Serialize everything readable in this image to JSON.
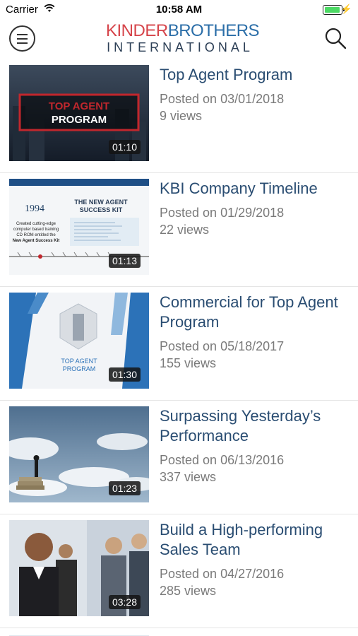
{
  "status_bar": {
    "carrier": "Carrier",
    "time": "10:58 AM"
  },
  "header": {
    "logo_line1_part1": "KINDER",
    "logo_line1_part2": "BROTHERS",
    "logo_line2": "INTERNATIONAL",
    "icons": {
      "menu": "menu-icon",
      "search": "search-icon"
    }
  },
  "videos": [
    {
      "title": "Top Agent Program",
      "posted": "Posted on 03/01/2018",
      "views": "9 views",
      "duration": "01:10",
      "thumb_text": [
        "TOP AGENT",
        "PROGRAM"
      ]
    },
    {
      "title": "KBI Company Timeline",
      "posted": "Posted on 01/29/2018",
      "views": "22 views",
      "duration": "01:13",
      "thumb_text": [
        "1994",
        "THE NEW AGENT",
        "SUCCESS KIT",
        "Created cutting-edge",
        "computer based training",
        "CD ROM entitled the",
        "New Agent Success Kit"
      ]
    },
    {
      "title": "Commercial for Top Agent Program",
      "posted": "Posted on 05/18/2017",
      "views": "155 views",
      "duration": "01:30",
      "thumb_text": [
        "TOP AGENT",
        "PROGRAM"
      ]
    },
    {
      "title": "Surpassing Yesterday’s Performance",
      "posted": "Posted on 06/13/2016",
      "views": "337 views",
      "duration": "01:23"
    },
    {
      "title": "Build a High-performing Sales Team",
      "posted": "Posted on 04/27/2016",
      "views": "285 views",
      "duration": "03:28"
    }
  ]
}
